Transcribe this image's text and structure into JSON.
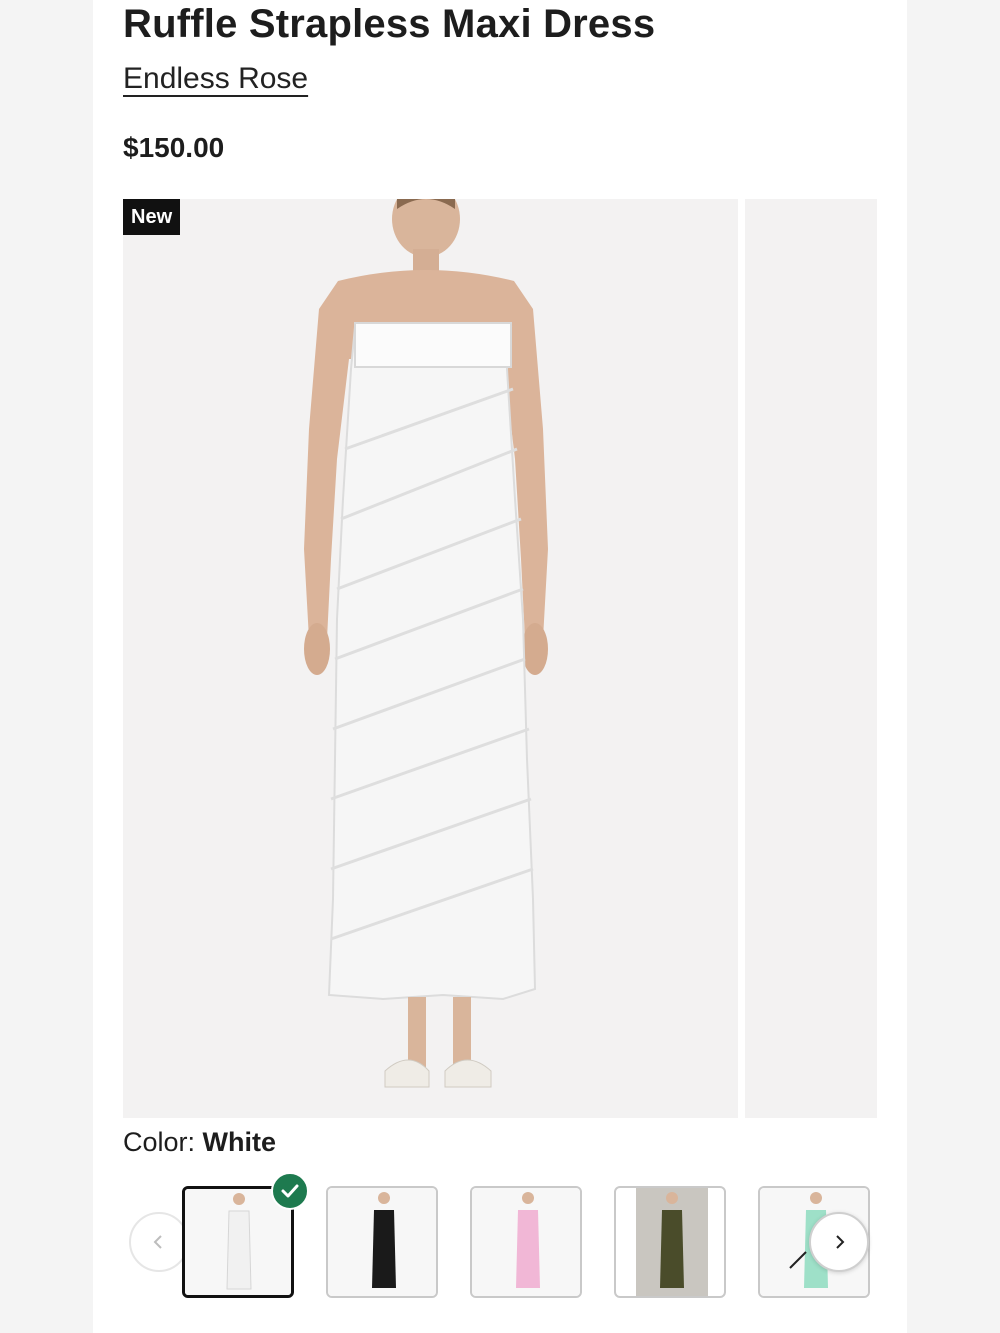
{
  "product": {
    "title": "Ruffle Strapless Maxi Dress",
    "brand": "Endless Rose",
    "price": "$150.00",
    "badge": "New"
  },
  "color_selector": {
    "label": "Color: ",
    "selected_value": "White",
    "swatches": [
      {
        "color_name": "white",
        "color": "#f2f2f2",
        "selected": true
      },
      {
        "color_name": "black",
        "color": "#1a1a1a",
        "selected": false
      },
      {
        "color_name": "pink",
        "color": "#f1b7d6",
        "selected": false
      },
      {
        "color_name": "olive",
        "color": "#4a4c2a",
        "selected": false
      },
      {
        "color_name": "mint",
        "color": "#9ee0c8",
        "selected": false
      }
    ]
  },
  "icons": {
    "prev": "chevron-left-icon",
    "next": "chevron-right-icon",
    "selected": "check-icon"
  },
  "colors": {
    "badge_bg": "#111111",
    "check_bg": "#1e7a4f",
    "image_bg": "#f3f2f2"
  }
}
